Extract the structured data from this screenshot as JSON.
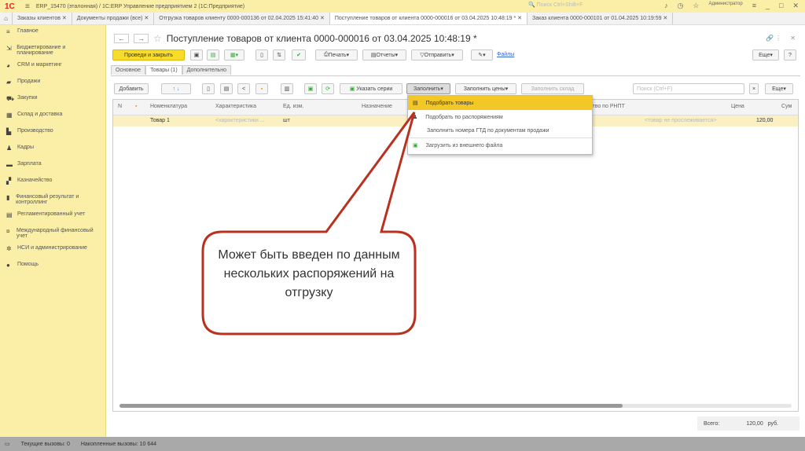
{
  "titlebar": {
    "logo": "1С",
    "title": "ERP_15470 (эталонная) / 1С:ERP Управление предприятием 2  (1С:Предприятие)",
    "search_placeholder": "Поиск Ctrl+Shift+F",
    "user": "Администратор"
  },
  "tabs": [
    "Заказы клиентов",
    "Документы продажи (все)",
    "Отгрузка товаров клиенту 0000-000136 от 02.04.2025 15:41:40",
    "Поступление товаров от клиента 0000-000016 от 03.04.2025 10:48:19 *",
    "Заказ клиента 0000-000101 от 01.04.2025 10:19:59"
  ],
  "sidebar": [
    {
      "icon": "menu-icon",
      "label": "Главное"
    },
    {
      "icon": "budget-icon",
      "label": "Бюджетирование и планирование"
    },
    {
      "icon": "pie-icon",
      "label": "CRM и маркетинг"
    },
    {
      "icon": "bag-icon",
      "label": "Продажи"
    },
    {
      "icon": "cart-icon",
      "label": "Закупки"
    },
    {
      "icon": "warehouse-icon",
      "label": "Склад и доставка"
    },
    {
      "icon": "factory-icon",
      "label": "Производство"
    },
    {
      "icon": "person-icon",
      "label": "Кадры"
    },
    {
      "icon": "wallet-icon",
      "label": "Зарплата"
    },
    {
      "icon": "coins-icon",
      "label": "Казначейство"
    },
    {
      "icon": "chart-icon",
      "label": "Финансовый результат и контроллинг"
    },
    {
      "icon": "doc-icon",
      "label": "Регламентированный учет"
    },
    {
      "icon": "intl-icon",
      "label": "Международный финансовый учет"
    },
    {
      "icon": "gear-icon",
      "label": "НСИ и администрирование"
    },
    {
      "icon": "help-icon",
      "label": "Помощь"
    }
  ],
  "doc": {
    "title": "Поступление товаров от клиента 0000-000016 от 03.04.2025 10:48:19 *",
    "post_close": "Проведи и закрыть",
    "print": "Печать",
    "reports": "Отчеты",
    "send": "Отправить",
    "files": "Файлы",
    "more": "Еще"
  },
  "doc_tabs": [
    "Основное",
    "Товары (1)",
    "Дополнительно"
  ],
  "table_toolbar": {
    "add": "Добавить",
    "series": "Указать серии",
    "fill": "Заполнить",
    "fill_prices": "Заполнить цены",
    "fill_warehouse": "Заполнить склад",
    "search_placeholder": "Поиск (Ctrl+F)",
    "more": "Еще"
  },
  "table": {
    "headers": [
      "N",
      "Номенклатура",
      "Характеристика",
      "Ед. изм.",
      "Назначение",
      "ство по РНПТ",
      "Цена",
      "Сум"
    ],
    "rows": [
      {
        "name": "Товар 1",
        "char": "<характеристики ...",
        "unit": "шт",
        "rnpt": "<товар не прослеживается>",
        "price": "120,00"
      }
    ]
  },
  "fill_menu": [
    "Подобрать товары",
    "Подобрать по распоряжениям",
    "Заполнить номера ГТД по документам продажи",
    "Загрузить из внешнего файла"
  ],
  "total": {
    "label": "Всего:",
    "value": "120,00",
    "currency": "руб."
  },
  "status": {
    "current": "Текущие вызовы: 0",
    "accumulated": "Накопленные вызовы: 10 644"
  },
  "callout": {
    "text": "Может быть введен по данным нескольких распоряжений на отгрузку",
    "color": "#b8321f"
  }
}
